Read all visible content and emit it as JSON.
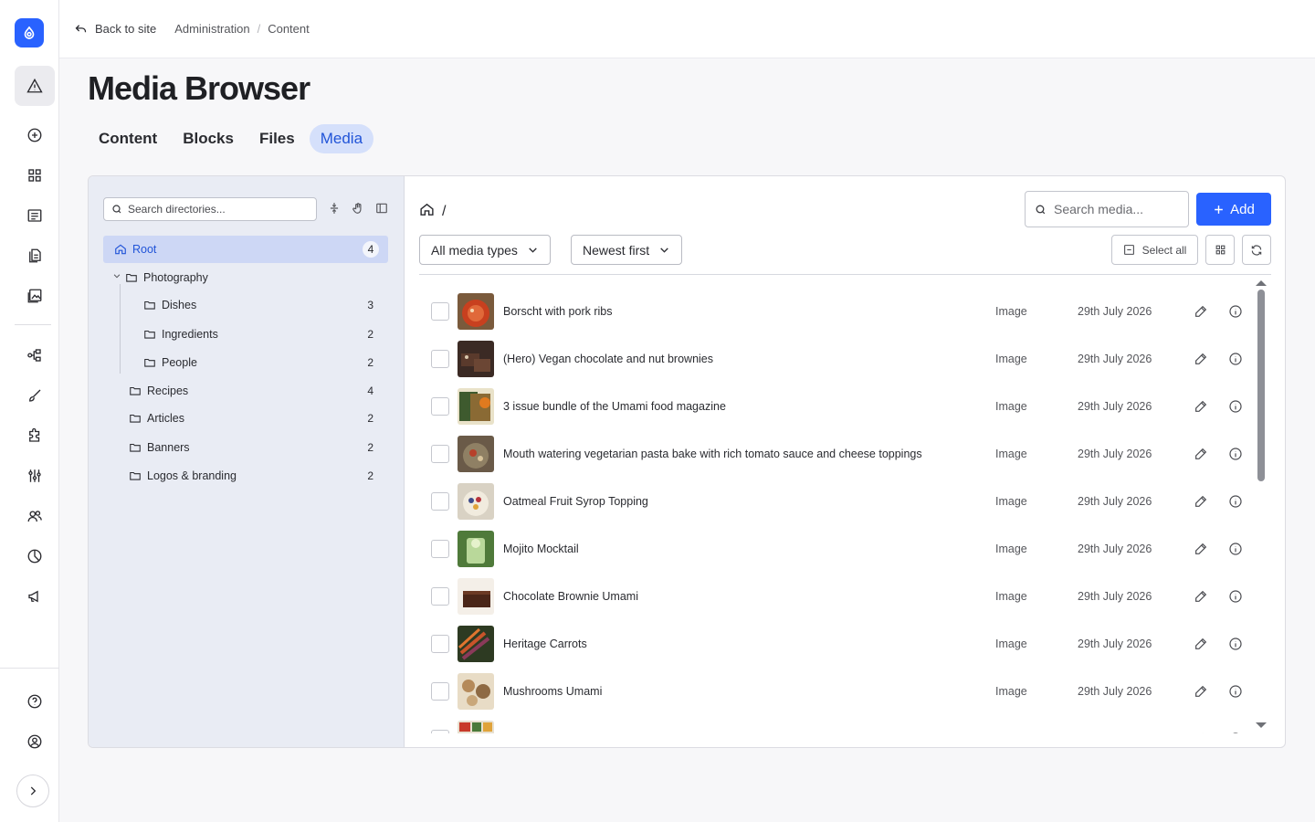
{
  "topbar": {
    "back_label": "Back to site",
    "crumbs": [
      "Administration",
      "Content"
    ]
  },
  "page": {
    "title": "Media Browser",
    "tabs": [
      {
        "label": "Content",
        "active": false
      },
      {
        "label": "Blocks",
        "active": false
      },
      {
        "label": "Files",
        "active": false
      },
      {
        "label": "Media",
        "active": true
      }
    ]
  },
  "colors": {
    "accent": "#2962ff",
    "active_tab_bg": "#d5e0fb",
    "tree_bg": "#e9ecf4"
  },
  "tree": {
    "search_placeholder": "Search directories...",
    "root": {
      "label": "Root",
      "count": "4"
    },
    "items": [
      {
        "label": "Photography",
        "count": "",
        "level": 1,
        "expanded": true
      },
      {
        "label": "Dishes",
        "count": "3",
        "level": 2
      },
      {
        "label": "Ingredients",
        "count": "2",
        "level": 2
      },
      {
        "label": "People",
        "count": "2",
        "level": 2
      },
      {
        "label": "Recipes",
        "count": "4",
        "level": 1
      },
      {
        "label": "Articles",
        "count": "2",
        "level": 1
      },
      {
        "label": "Banners",
        "count": "2",
        "level": 1
      },
      {
        "label": "Logos & branding",
        "count": "2",
        "level": 1
      }
    ]
  },
  "toolbar": {
    "path_separator": "/",
    "search_placeholder": "Search media...",
    "add_label": "Add",
    "type_filter": "All media types",
    "sort": "Newest first",
    "select_all_label": "Select all"
  },
  "media": {
    "rows": [
      {
        "name": "Borscht with pork ribs",
        "type": "Image",
        "date": "29th July 2026"
      },
      {
        "name": "(Hero) Vegan chocolate and nut brownies",
        "type": "Image",
        "date": "29th July 2026"
      },
      {
        "name": "3 issue bundle of the Umami food magazine",
        "type": "Image",
        "date": "29th July 2026"
      },
      {
        "name": "Mouth watering vegetarian pasta bake with rich tomato sauce and cheese toppings",
        "type": "Image",
        "date": "29th July 2026"
      },
      {
        "name": "Oatmeal Fruit Syrop Topping",
        "type": "Image",
        "date": "29th July 2026"
      },
      {
        "name": "Mojito Mocktail",
        "type": "Image",
        "date": "29th July 2026"
      },
      {
        "name": "Chocolate Brownie Umami",
        "type": "Image",
        "date": "29th July 2026"
      },
      {
        "name": "Heritage Carrots",
        "type": "Image",
        "date": "29th July 2026"
      },
      {
        "name": "Mushrooms Umami",
        "type": "Image",
        "date": "29th July 2026"
      },
      {
        "name": "",
        "type": "",
        "date": ""
      }
    ]
  }
}
